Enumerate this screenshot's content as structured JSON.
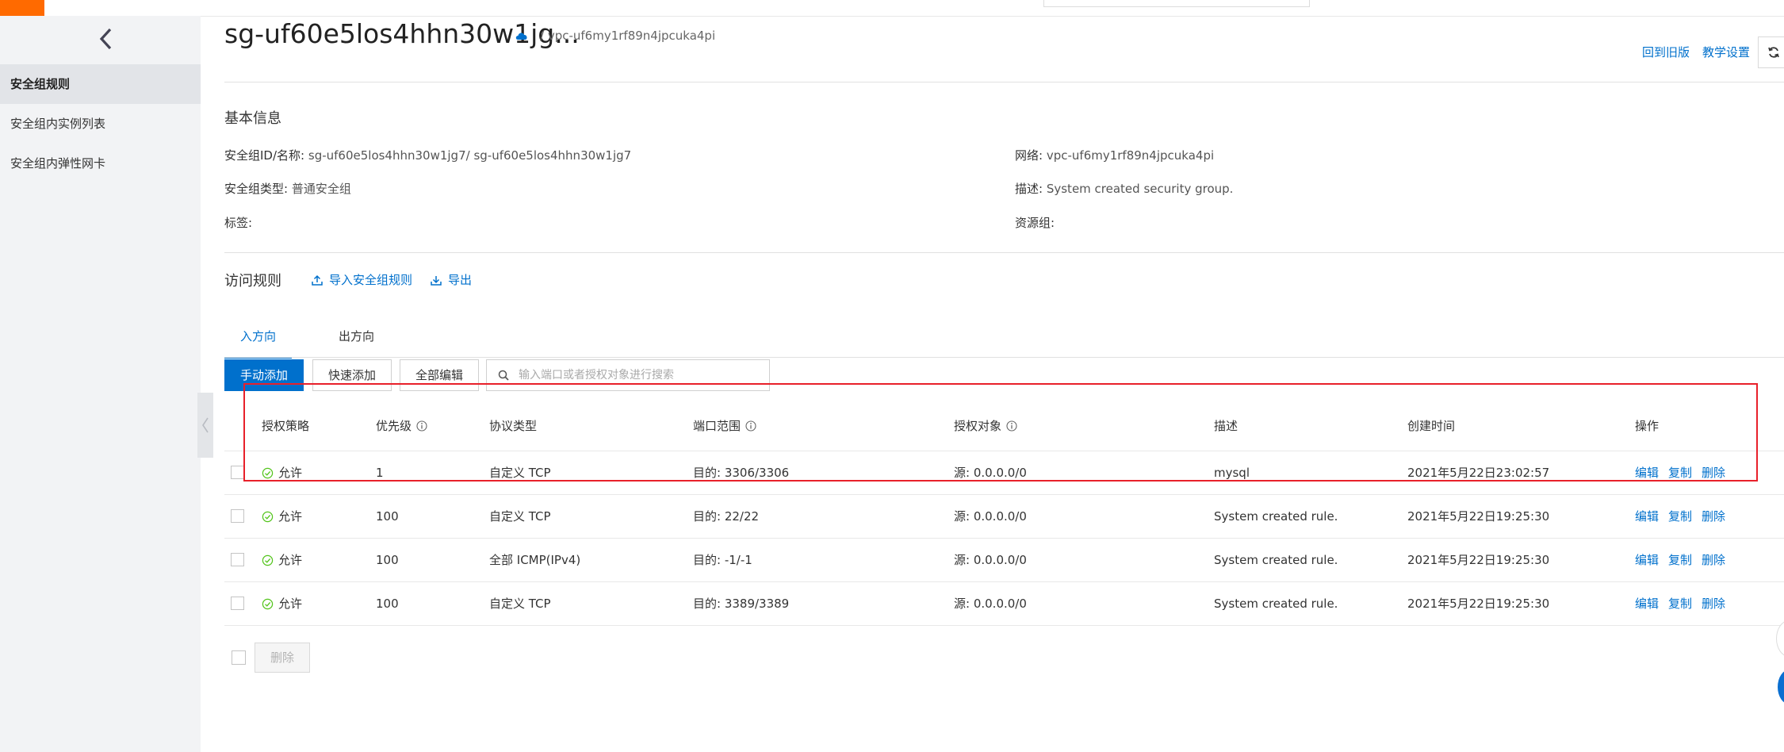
{
  "header": {
    "title": "sg-uf60e5los4hhn30w1jg...",
    "breadcrumb": "/ vpc-uf6my1rf89n4jpcuka4pi",
    "links": {
      "old_version": "回到旧版",
      "tutorial": "教学设置"
    }
  },
  "sidebar": {
    "items": [
      {
        "label": "安全组规则",
        "active": true
      },
      {
        "label": "安全组内实例列表",
        "active": false
      },
      {
        "label": "安全组内弹性网卡",
        "active": false
      }
    ]
  },
  "basic_info": {
    "title": "基本信息",
    "id_name_label": "安全组ID/名称:",
    "id_name_value": "sg-uf60e5los4hhn30w1jg7/ sg-uf60e5los4hhn30w1jg7",
    "network_label": "网络:",
    "network_value": "vpc-uf6my1rf89n4jpcuka4pi",
    "type_label": "安全组类型:",
    "type_value": "普通安全组",
    "desc_label": "描述:",
    "desc_value": "System created security group.",
    "tags_label": "标签:",
    "resource_group_label": "资源组:"
  },
  "rules": {
    "title": "访问规则",
    "import_label": "导入安全组规则",
    "export_label": "导出",
    "tabs": [
      {
        "label": "入方向",
        "active": true
      },
      {
        "label": "出方向",
        "active": false
      }
    ],
    "buttons": {
      "manual_add": "手动添加",
      "quick_add": "快速添加",
      "edit_all": "全部编辑"
    },
    "search_placeholder": "输入端口或者授权对象进行搜索",
    "columns": {
      "policy": "授权策略",
      "priority": "优先级",
      "protocol": "协议类型",
      "port": "端口范围",
      "object": "授权对象",
      "desc": "描述",
      "created": "创建时间",
      "ops": "操作"
    },
    "rows": [
      {
        "policy": "允许",
        "priority": "1",
        "protocol": "自定义 TCP",
        "port": "目的: 3306/3306",
        "object": "源: 0.0.0.0/0",
        "desc": "mysql",
        "created": "2021年5月22日23:02:57"
      },
      {
        "policy": "允许",
        "priority": "100",
        "protocol": "自定义 TCP",
        "port": "目的: 22/22",
        "object": "源: 0.0.0.0/0",
        "desc": "System created rule.",
        "created": "2021年5月22日19:25:30"
      },
      {
        "policy": "允许",
        "priority": "100",
        "protocol": "全部 ICMP(IPv4)",
        "port": "目的: -1/-1",
        "object": "源: 0.0.0.0/0",
        "desc": "System created rule.",
        "created": "2021年5月22日19:25:30"
      },
      {
        "policy": "允许",
        "priority": "100",
        "protocol": "自定义 TCP",
        "port": "目的: 3389/3389",
        "object": "源: 0.0.0.0/0",
        "desc": "System created rule.",
        "created": "2021年5月22日19:25:30"
      }
    ],
    "op_labels": {
      "edit": "编辑",
      "copy": "复制",
      "delete": "删除"
    },
    "bulk_delete": "删除"
  },
  "colors": {
    "accent": "#0070cc",
    "brand": "#ff6a00",
    "success": "#52c41a",
    "highlight": "#e8202a"
  }
}
